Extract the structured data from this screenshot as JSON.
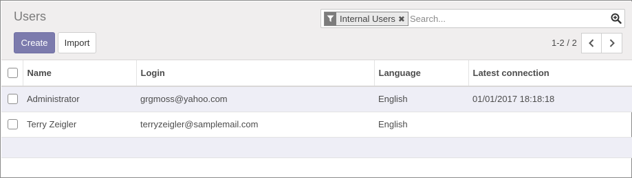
{
  "page": {
    "title": "Users"
  },
  "search": {
    "facet_label": "Internal Users",
    "facet_icon": "filter-icon",
    "remove_icon": "close-icon",
    "placeholder": "Search...",
    "search_icon": "search-plus-icon"
  },
  "buttons": {
    "create": "Create",
    "import": "Import"
  },
  "pager": {
    "value": "1-2 / 2",
    "prev_icon": "chevron-left-icon",
    "next_icon": "chevron-right-icon"
  },
  "table": {
    "headers": [
      "Name",
      "Login",
      "Language",
      "Latest connection"
    ],
    "rows": [
      {
        "name": "Administrator",
        "login": "grgmoss@yahoo.com",
        "language": "English",
        "latest_connection": "01/01/2017 18:18:18"
      },
      {
        "name": "Terry Zeigler",
        "login": "terryzeigler@samplemail.com",
        "language": "English",
        "latest_connection": ""
      }
    ]
  },
  "colors": {
    "primary": "#7c7bad",
    "panel_bg": "#f0eeee",
    "row_highlight": "#eeeef6"
  }
}
